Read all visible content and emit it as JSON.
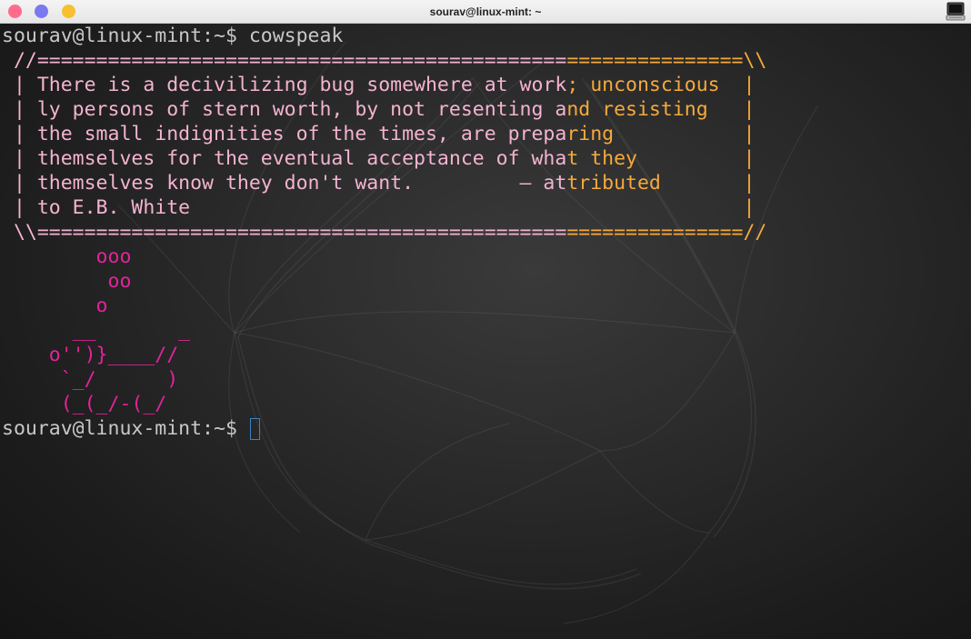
{
  "window": {
    "title": "sourav@linux-mint: ~"
  },
  "terminal": {
    "lines": [
      {
        "prompt": "sourav@linux-mint:~$ ",
        "command": "cowspeak"
      },
      {
        "text": " //============================================================\\\\"
      },
      {
        "text": " | There is a decivilizing bug somewhere at work; unconscious  |"
      },
      {
        "text": " | ly persons of stern worth, by not resenting and resisting   |"
      },
      {
        "text": " | the small indignities of the times, are preparing           |"
      },
      {
        "text": " | themselves for the eventual acceptance of what they         |"
      },
      {
        "text": " | themselves know they don't want.         — attributed       |"
      },
      {
        "text": " | to E.B. White                                               |"
      },
      {
        "text": " \\\\============================================================//"
      },
      {
        "text": "        ooo"
      },
      {
        "text": "         oo"
      },
      {
        "text": "        o"
      },
      {
        "text": "      __       _"
      },
      {
        "text": "    o'')}____//"
      },
      {
        "text": "     `_/      )"
      },
      {
        "text": "     (_(_/-(_/"
      },
      {
        "prompt": "sourav@linux-mint:~$ ",
        "command": ""
      }
    ]
  },
  "colors": {
    "prompt": "#c8c8c8",
    "quote_pink": "#f4b3d0",
    "quote_orange": "#f6a93b",
    "cow": "#e3239a",
    "cursor": "#3b82c4",
    "close_button": "#ff6b8b",
    "minimize_button": "#7b79ee",
    "maximize_button": "#f6c02f"
  },
  "icons": {
    "app_icon": "terminal-icon"
  }
}
